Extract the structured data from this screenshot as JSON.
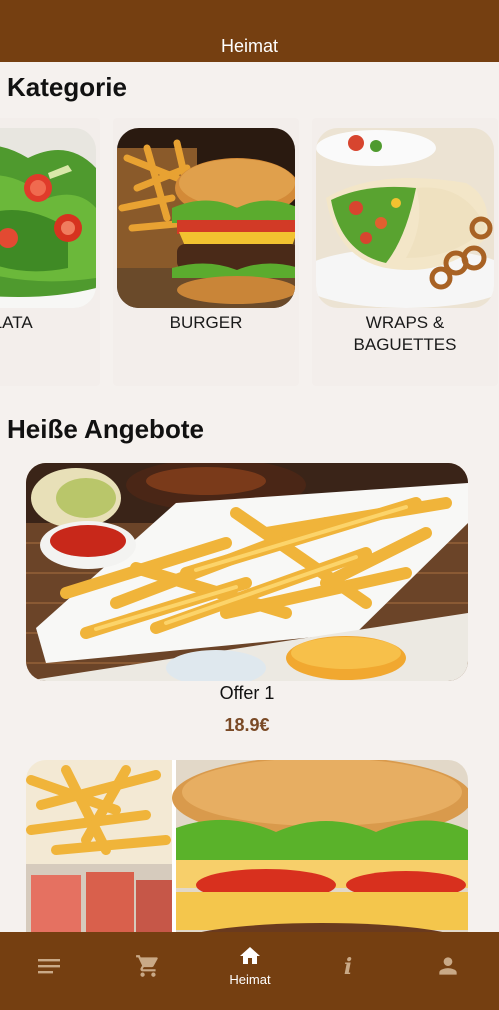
{
  "header": {
    "title": "Heimat"
  },
  "categories": {
    "title": "Kategorie",
    "items": [
      {
        "label": "ALATA",
        "image": "salad-photo"
      },
      {
        "label": "BURGER",
        "image": "burger-photo"
      },
      {
        "label": "WRAPS & BAGUETTES",
        "image": "wrap-photo"
      }
    ]
  },
  "offers": {
    "title": "Heiße Angebote",
    "items": [
      {
        "name": "Offer 1",
        "price": "18.9€",
        "image": "fries-ketchup-photo"
      },
      {
        "name": "",
        "price": "",
        "image": "fries-burger-collage-photo"
      }
    ]
  },
  "bottom_nav": {
    "items": [
      {
        "icon": "menu-icon"
      },
      {
        "icon": "cart-icon"
      },
      {
        "icon": "home-icon",
        "label": "Heimat",
        "active": true
      },
      {
        "icon": "info-icon"
      },
      {
        "icon": "person-icon"
      }
    ]
  },
  "colors": {
    "bar": "#753f11",
    "background": "#f5f1ee",
    "price": "#7a4a26"
  }
}
